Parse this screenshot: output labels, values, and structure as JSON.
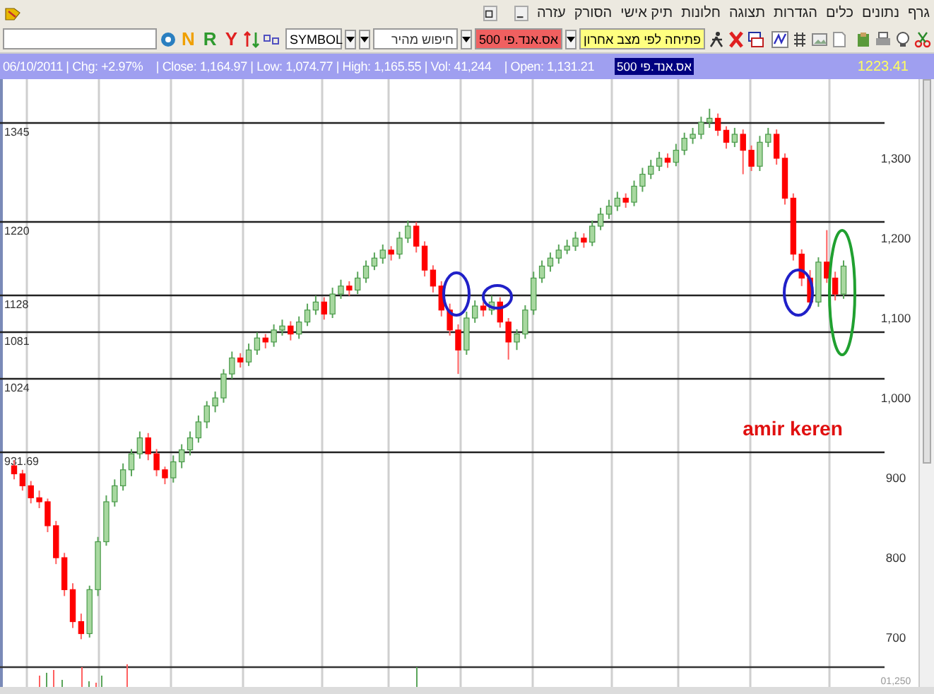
{
  "menu": [
    "גרף",
    "נתונים",
    "כלים",
    "הגדרות",
    "תצוגה",
    "חלונות",
    "תיק אישי",
    "הסורק",
    "עזרה"
  ],
  "toolbar": {
    "letter_buttons": {
      "left": {
        "label": "N",
        "color": "#f0a000"
      },
      "middle": {
        "label": "R",
        "color": "#2f9a2f"
      },
      "right": {
        "label": "Y",
        "color": "#e02020"
      }
    },
    "symbol_select": {
      "value": "SYMBOL"
    },
    "quick_search": {
      "placeholder": "חיפוש מהיר"
    },
    "index_select": {
      "value": "אס.אנד.פי 500"
    },
    "layout_select": {
      "value": "פתיחה לפי מצב אחרון"
    }
  },
  "info_bar": {
    "stats": "06/10/2011 | Chg: +2.97%    | Close: 1,164.97 | Low: 1,074.77 | High: 1,165.55 | Vol: 41,244    | Open: 1,131.21",
    "symbol_badge": "אס.אנד.פי 500",
    "last_value": "1223.41"
  },
  "chart": {
    "level_labels": [
      "1345",
      "1220",
      "1128",
      "1081",
      "1024",
      "931.69"
    ],
    "annotation": "amir keren",
    "lower_axis_label": "01,250",
    "chart_data": {
      "type": "candlestick",
      "ylim": [
        663,
        1399
      ],
      "yticks": [
        {
          "value": 1300,
          "label": "1,300"
        },
        {
          "value": 1200,
          "label": "1,200"
        },
        {
          "value": 1100,
          "label": "1,100"
        },
        {
          "value": 1000,
          "label": "1,000"
        },
        {
          "value": 900,
          "label": "900"
        },
        {
          "value": 800,
          "label": "800"
        },
        {
          "value": 700,
          "label": "700"
        }
      ],
      "ohlc": [
        [
          915,
          922,
          898,
          905
        ],
        [
          905,
          910,
          884,
          890
        ],
        [
          890,
          896,
          868,
          875
        ],
        [
          875,
          884,
          862,
          870
        ],
        [
          870,
          874,
          832,
          840
        ],
        [
          840,
          846,
          792,
          800
        ],
        [
          800,
          806,
          752,
          760
        ],
        [
          760,
          768,
          712,
          720
        ],
        [
          720,
          730,
          698,
          705
        ],
        [
          705,
          765,
          700,
          760
        ],
        [
          760,
          826,
          752,
          820
        ],
        [
          820,
          878,
          815,
          870
        ],
        [
          870,
          898,
          864,
          890
        ],
        [
          890,
          918,
          884,
          910
        ],
        [
          910,
          936,
          902,
          930
        ],
        [
          930,
          958,
          924,
          950
        ],
        [
          950,
          956,
          922,
          930
        ],
        [
          930,
          936,
          902,
          910
        ],
        [
          910,
          914,
          892,
          900
        ],
        [
          900,
          928,
          894,
          920
        ],
        [
          920,
          942,
          912,
          935
        ],
        [
          935,
          958,
          928,
          950
        ],
        [
          950,
          978,
          944,
          970
        ],
        [
          970,
          996,
          962,
          990
        ],
        [
          990,
          1008,
          982,
          1000
        ],
        [
          1000,
          1036,
          994,
          1030
        ],
        [
          1030,
          1058,
          1024,
          1050
        ],
        [
          1050,
          1056,
          1038,
          1045
        ],
        [
          1045,
          1068,
          1040,
          1060
        ],
        [
          1060,
          1082,
          1054,
          1075
        ],
        [
          1075,
          1080,
          1062,
          1070
        ],
        [
          1070,
          1092,
          1064,
          1085
        ],
        [
          1085,
          1098,
          1078,
          1090
        ],
        [
          1090,
          1096,
          1072,
          1080
        ],
        [
          1080,
          1102,
          1074,
          1095
        ],
        [
          1095,
          1118,
          1090,
          1110
        ],
        [
          1110,
          1128,
          1104,
          1120
        ],
        [
          1120,
          1126,
          1098,
          1105
        ],
        [
          1105,
          1138,
          1100,
          1130
        ],
        [
          1130,
          1148,
          1124,
          1140
        ],
        [
          1140,
          1146,
          1128,
          1135
        ],
        [
          1135,
          1158,
          1130,
          1150
        ],
        [
          1150,
          1172,
          1144,
          1165
        ],
        [
          1165,
          1182,
          1160,
          1175
        ],
        [
          1175,
          1192,
          1168,
          1185
        ],
        [
          1185,
          1190,
          1172,
          1180
        ],
        [
          1180,
          1208,
          1174,
          1200
        ],
        [
          1200,
          1222,
          1194,
          1215
        ],
        [
          1215,
          1220,
          1182,
          1190
        ],
        [
          1190,
          1196,
          1152,
          1160
        ],
        [
          1160,
          1166,
          1132,
          1140
        ],
        [
          1140,
          1146,
          1102,
          1110
        ],
        [
          1110,
          1118,
          1078,
          1085
        ],
        [
          1085,
          1092,
          1030,
          1060
        ],
        [
          1060,
          1108,
          1054,
          1100
        ],
        [
          1100,
          1122,
          1094,
          1115
        ],
        [
          1115,
          1120,
          1102,
          1110
        ],
        [
          1110,
          1128,
          1104,
          1120
        ],
        [
          1120,
          1126,
          1088,
          1095
        ],
        [
          1095,
          1100,
          1048,
          1070
        ],
        [
          1070,
          1086,
          1060,
          1080
        ],
        [
          1080,
          1116,
          1074,
          1110
        ],
        [
          1110,
          1158,
          1104,
          1150
        ],
        [
          1150,
          1172,
          1144,
          1165
        ],
        [
          1165,
          1182,
          1158,
          1175
        ],
        [
          1175,
          1192,
          1168,
          1185
        ],
        [
          1185,
          1198,
          1180,
          1190
        ],
        [
          1190,
          1208,
          1184,
          1200
        ],
        [
          1200,
          1206,
          1188,
          1195
        ],
        [
          1195,
          1222,
          1190,
          1215
        ],
        [
          1215,
          1238,
          1210,
          1230
        ],
        [
          1230,
          1248,
          1224,
          1240
        ],
        [
          1240,
          1258,
          1234,
          1250
        ],
        [
          1250,
          1256,
          1238,
          1245
        ],
        [
          1245,
          1272,
          1240,
          1265
        ],
        [
          1265,
          1288,
          1258,
          1280
        ],
        [
          1280,
          1298,
          1274,
          1290
        ],
        [
          1290,
          1308,
          1284,
          1300
        ],
        [
          1300,
          1306,
          1288,
          1295
        ],
        [
          1295,
          1318,
          1290,
          1310
        ],
        [
          1310,
          1332,
          1304,
          1325
        ],
        [
          1325,
          1338,
          1318,
          1330
        ],
        [
          1330,
          1352,
          1324,
          1345
        ],
        [
          1345,
          1362,
          1338,
          1350
        ],
        [
          1350,
          1356,
          1328,
          1335
        ],
        [
          1335,
          1340,
          1312,
          1320
        ],
        [
          1320,
          1338,
          1314,
          1330
        ],
        [
          1330,
          1336,
          1280,
          1310
        ],
        [
          1310,
          1316,
          1284,
          1290
        ],
        [
          1290,
          1328,
          1284,
          1320
        ],
        [
          1320,
          1338,
          1314,
          1330
        ],
        [
          1330,
          1336,
          1292,
          1300
        ],
        [
          1300,
          1306,
          1242,
          1250
        ],
        [
          1250,
          1256,
          1172,
          1180
        ],
        [
          1180,
          1186,
          1140,
          1150
        ],
        [
          1150,
          1160,
          1112,
          1120
        ],
        [
          1120,
          1176,
          1114,
          1170
        ],
        [
          1170,
          1210,
          1144,
          1150
        ],
        [
          1150,
          1158,
          1122,
          1130
        ],
        [
          1130,
          1172,
          1124,
          1165
        ]
      ]
    }
  }
}
